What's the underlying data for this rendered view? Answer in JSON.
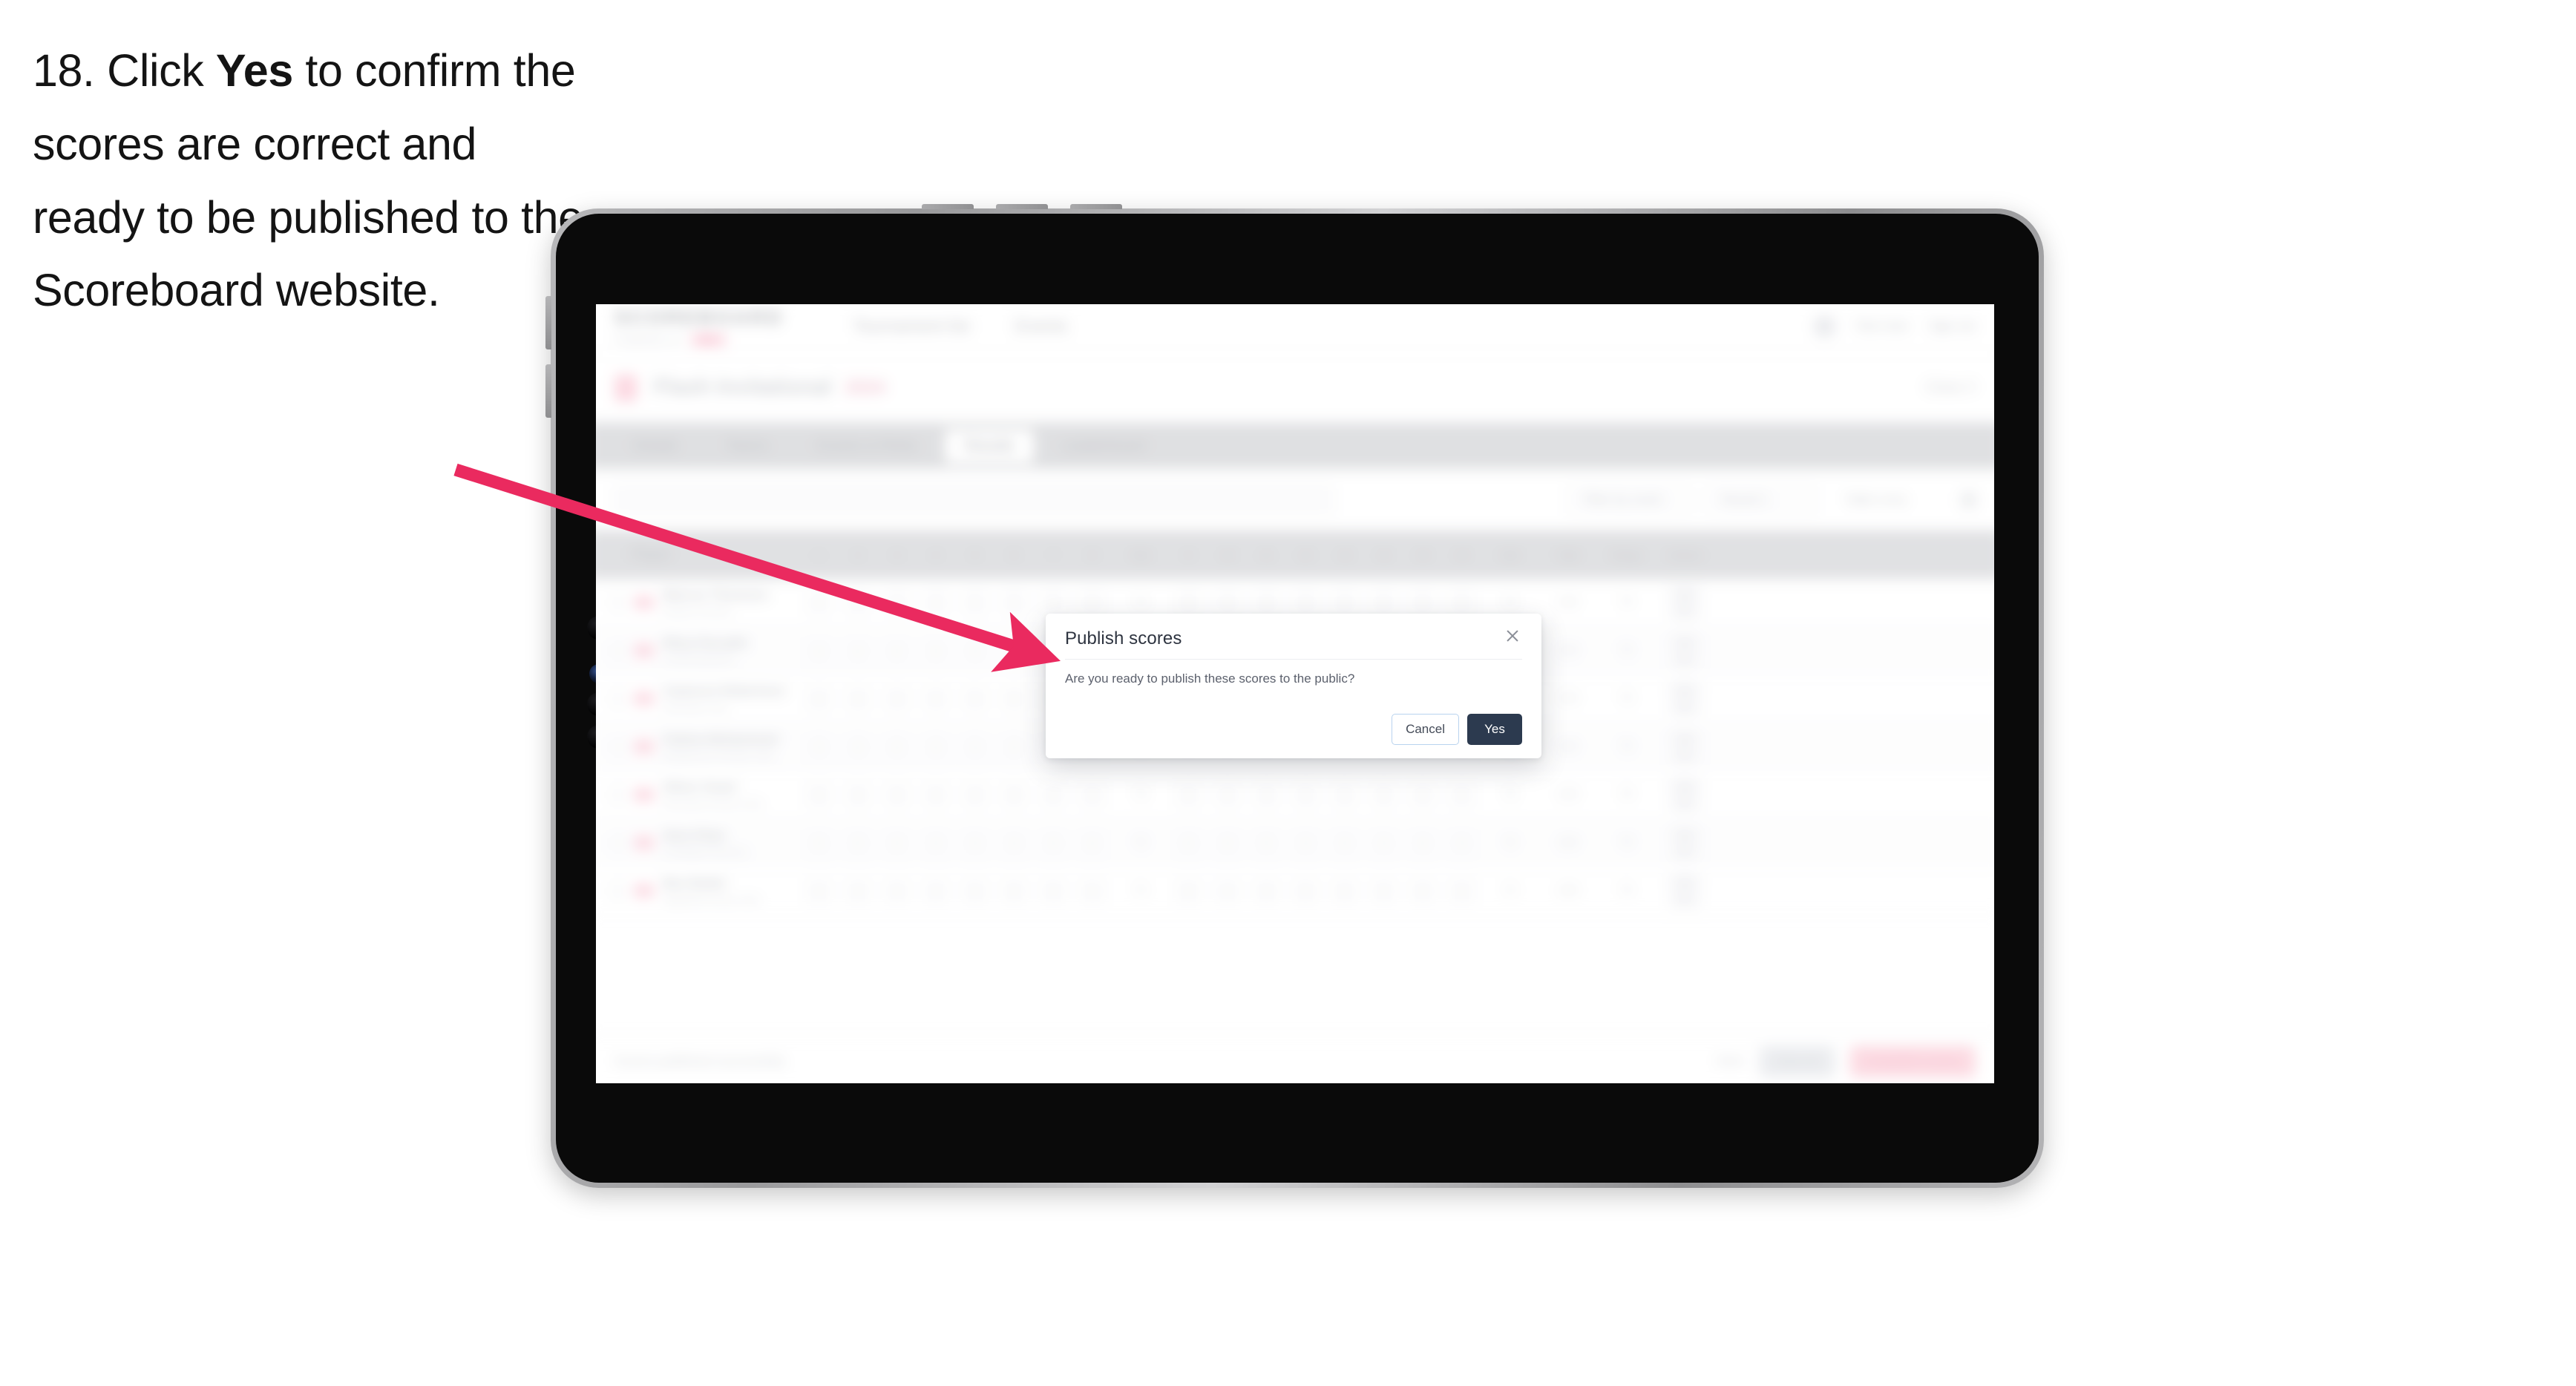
{
  "caption": {
    "step_number": "18.",
    "text_before": "Click ",
    "bold_word": "Yes",
    "text_after": " to confirm the scores are correct and ready to be published to the Scoreboard website."
  },
  "annotation": {
    "arrow_color": "#ea2a5f",
    "points_to": "yes-button"
  },
  "device": {
    "type": "tablet",
    "bezel_color": "#0a0a0a",
    "frame_color": "#b4b4b6"
  },
  "app": {
    "header": {
      "logo": "SCOREBOARD",
      "logo_sub": "POWERED BY",
      "logo_pill": "BETA",
      "nav": [
        {
          "label": "Tournament list"
        },
        {
          "label": "Events"
        }
      ],
      "right": [
        {
          "label": "Test User"
        },
        {
          "label": "Sign out"
        }
      ]
    },
    "title_strip": {
      "title": "Flash Invitational",
      "tag": "2024",
      "right_label": "Close X"
    },
    "tabs": [
      {
        "label": "Details",
        "active": false
      },
      {
        "label": "Teams",
        "active": false
      },
      {
        "label": "Events & Rinks",
        "active": false
      },
      {
        "label": "Results",
        "active": true
      },
      {
        "label": "Leaderboard",
        "active": false
      }
    ],
    "toolbar": {
      "search_placeholder": "Search players",
      "controls": [
        {
          "label": "Filter by event"
        },
        {
          "label": "Round 1"
        },
        {
          "label": "Table entry"
        }
      ]
    },
    "table": {
      "columns": [
        "Player",
        "1",
        "2",
        "3",
        "4",
        "5",
        "6",
        "7",
        "8",
        "Sub",
        "9",
        "10",
        "11",
        "12",
        "13",
        "14",
        "15",
        "16",
        "Sub",
        "Total",
        "Range",
        "Actions"
      ],
      "rows": [
        {
          "name": "Marcus Thomson",
          "club": "Eastern Archers",
          "scores": [
            "9",
            "9",
            "9",
            "9",
            "9",
            "9",
            "9",
            "9",
            "72",
            "9",
            "9",
            "9",
            "9",
            "9",
            "9",
            "9",
            "9",
            "72"
          ],
          "total": "144",
          "range": "70",
          "actions": [
            "Edit",
            "Del"
          ]
        },
        {
          "name": "Rhea Parvathi",
          "club": "Central Bowmen",
          "scores": [
            "9",
            "9",
            "9",
            "9",
            "9",
            "9",
            "9",
            "9",
            "72",
            "9",
            "9",
            "9",
            "9",
            "9",
            "9",
            "9",
            "9",
            "72"
          ],
          "total": "144",
          "range": "70",
          "actions": [
            "Edit",
            "Del"
          ]
        },
        {
          "name": "Cameron Robertson",
          "club": "Northside Club",
          "scores": [
            "9",
            "9",
            "9",
            "9",
            "9",
            "9",
            "9",
            "9",
            "72",
            "9",
            "9",
            "9",
            "9",
            "9",
            "9",
            "9",
            "9",
            "72"
          ],
          "total": "144",
          "range": "70",
          "actions": [
            "Edit",
            "Del"
          ]
        },
        {
          "name": "Fatima Mohammed",
          "club": "Westbourne Archery Club",
          "scores": [
            "9",
            "9",
            "9",
            "9",
            "9",
            "9",
            "9",
            "9",
            "72",
            "9",
            "9",
            "9",
            "9",
            "9",
            "9",
            "9",
            "9",
            "72"
          ],
          "total": "144",
          "range": "70",
          "actions": [
            "Edit",
            "Del"
          ]
        },
        {
          "name": "Oliver Grant",
          "club": "Riverside Archery Club",
          "scores": [
            "9",
            "9",
            "9",
            "9",
            "9",
            "9",
            "9",
            "9",
            "72",
            "9",
            "9",
            "9",
            "9",
            "9",
            "9",
            "9",
            "9",
            "72"
          ],
          "total": "144",
          "range": "70",
          "actions": [
            "Edit",
            "Del"
          ]
        },
        {
          "name": "Sara Khan",
          "club": "Southgate Bowmen",
          "scores": [
            "9",
            "9",
            "9",
            "9",
            "9",
            "9",
            "9",
            "9",
            "72",
            "9",
            "9",
            "9",
            "9",
            "9",
            "9",
            "9",
            "9",
            "72"
          ],
          "total": "144",
          "range": "70",
          "actions": [
            "Edit",
            "Del"
          ]
        },
        {
          "name": "Ben Butler",
          "club": "Highfield Archery Club",
          "scores": [
            "9",
            "9",
            "9",
            "9",
            "9",
            "9",
            "9",
            "9",
            "72",
            "9",
            "9",
            "9",
            "9",
            "9",
            "9",
            "9",
            "9",
            "72"
          ],
          "total": "144",
          "range": "70",
          "actions": [
            "Edit",
            "Del"
          ]
        }
      ]
    },
    "footer": {
      "note": "Scores published successfully",
      "link": "Back",
      "grey_button": "Save all",
      "pink_button": "Unpublish scores"
    }
  },
  "modal": {
    "title": "Publish scores",
    "message": "Are you ready to publish these scores to the public?",
    "cancel_label": "Cancel",
    "confirm_label": "Yes",
    "close_icon": "close-icon",
    "confirm_color": "#2c3a4f"
  }
}
